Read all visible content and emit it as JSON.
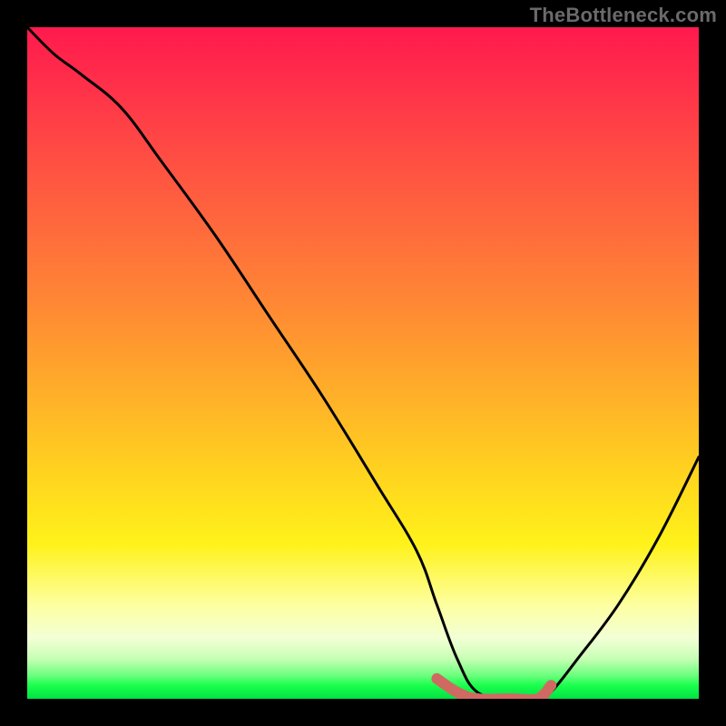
{
  "watermark": "TheBottleneck.com",
  "chart_data": {
    "type": "line",
    "title": "",
    "xlabel": "",
    "ylabel": "",
    "xlim": [
      0,
      100
    ],
    "ylim": [
      0,
      100
    ],
    "grid": false,
    "legend": false,
    "series": [
      {
        "name": "bottleneck-curve",
        "x": [
          0,
          4,
          8,
          14,
          20,
          28,
          36,
          44,
          52,
          58,
          61,
          64,
          67,
          72,
          76,
          78,
          82,
          88,
          94,
          100
        ],
        "y": [
          100,
          96,
          93,
          88,
          80,
          69,
          57,
          45,
          32,
          22,
          14,
          6,
          1,
          0,
          0,
          1,
          6,
          14,
          24,
          36
        ],
        "color": "#000000"
      },
      {
        "name": "optimal-range-highlight",
        "x": [
          61,
          64,
          67,
          72,
          76,
          78
        ],
        "y": [
          3,
          1,
          0,
          0,
          0,
          2
        ],
        "color": "#cf6a62"
      }
    ],
    "annotations": []
  },
  "colors": {
    "frame": "#000000",
    "curve": "#000000",
    "highlight": "#cf6a62"
  }
}
